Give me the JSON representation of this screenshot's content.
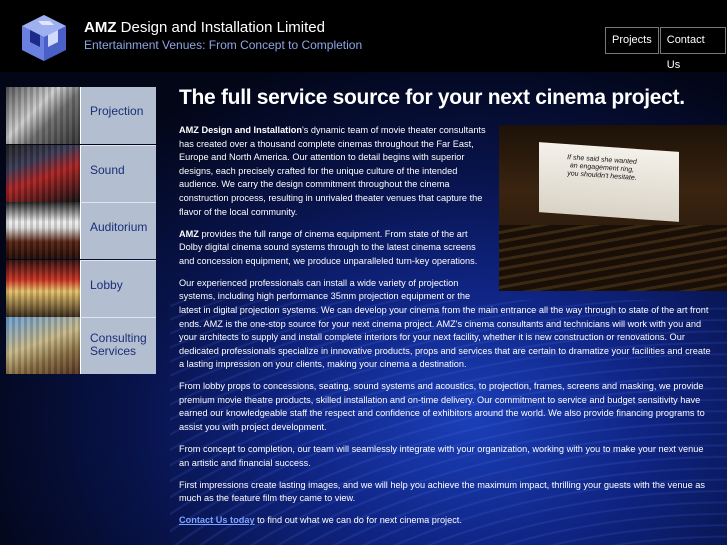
{
  "header": {
    "company_bold": "AMZ",
    "company_rest": " Design and Installation Limited",
    "tagline": "Entertainment Venues: From Concept to Completion"
  },
  "top_nav": [
    {
      "label": "Projects"
    },
    {
      "label": "Contact Us"
    }
  ],
  "side_nav": [
    {
      "label": "Projection"
    },
    {
      "label": "Sound"
    },
    {
      "label": "Auditorium"
    },
    {
      "label": "Lobby"
    },
    {
      "label": "Consulting Services"
    }
  ],
  "headline": "The full service source for your next cinema project.",
  "hero": {
    "screen_text": "If she said she wanted an engagement ring, you shouldn't hesitate."
  },
  "content": {
    "p1_bold": "AMZ Design and Installation",
    "p1_rest": "'s dynamic team of movie theater consultants has created over a thousand complete cinemas throughout the Far East, Europe and North America. Our attention to detail begins with superior designs, each precisely crafted for the unique culture of the intended audience. We carry the design commitment throughout the cinema construction process, resulting in unrivaled theater venues that capture the flavor of the local community.",
    "p2_bold": "AMZ",
    "p2_rest": " provides the full range of cinema equipment. From state of the art Dolby digital cinema sound systems through to the latest cinema screens and concession equipment, we produce unparalleled turn-key operations.",
    "p3": "Our experienced professionals can install a wide variety of projection systems, including high performance 35mm projection equipment or the latest in digital projection systems. We can develop your cinema from the main entrance all the way through to state of the art front ends. AMZ is the one-stop source for your next cinema project. AMZ's cinema consultants and technicians will work with you and your architects to supply and install complete interiors for your next facility, whether it is new construction or renovations. Our dedicated professionals specialize in innovative products, props and services that are certain to dramatize your facilities and create a lasting impression on your clients, making your cinema a destination.",
    "p4": "From lobby props to concessions, seating, sound systems and acoustics, to projection, frames, screens and masking, we provide premium movie theatre products, skilled installation and on-time delivery. Our commitment to service and budget sensitivity have earned our knowledgeable staff the respect and confidence of exhibitors around the world. We also provide financing programs to assist you with project development.",
    "p5": "From concept to completion, our team will seamlessly integrate with your organization, working with you to make your next venue an artistic and financial success.",
    "p6": "First impressions create lasting images, and we will help you achieve the maximum impact, thrilling your guests with the venue as much as the feature film they came to view.",
    "p7_link": "Contact Us today",
    "p7_rest": " to find out what we can do for next cinema project."
  },
  "colors": {
    "background": "#0f2482",
    "nav_label_bg": "#b3bfd0",
    "nav_label_text": "#1a2e78",
    "tagline": "#8ea6e8",
    "link": "#7fa3ff"
  },
  "icons": {
    "logo": "cube-logo-icon"
  }
}
